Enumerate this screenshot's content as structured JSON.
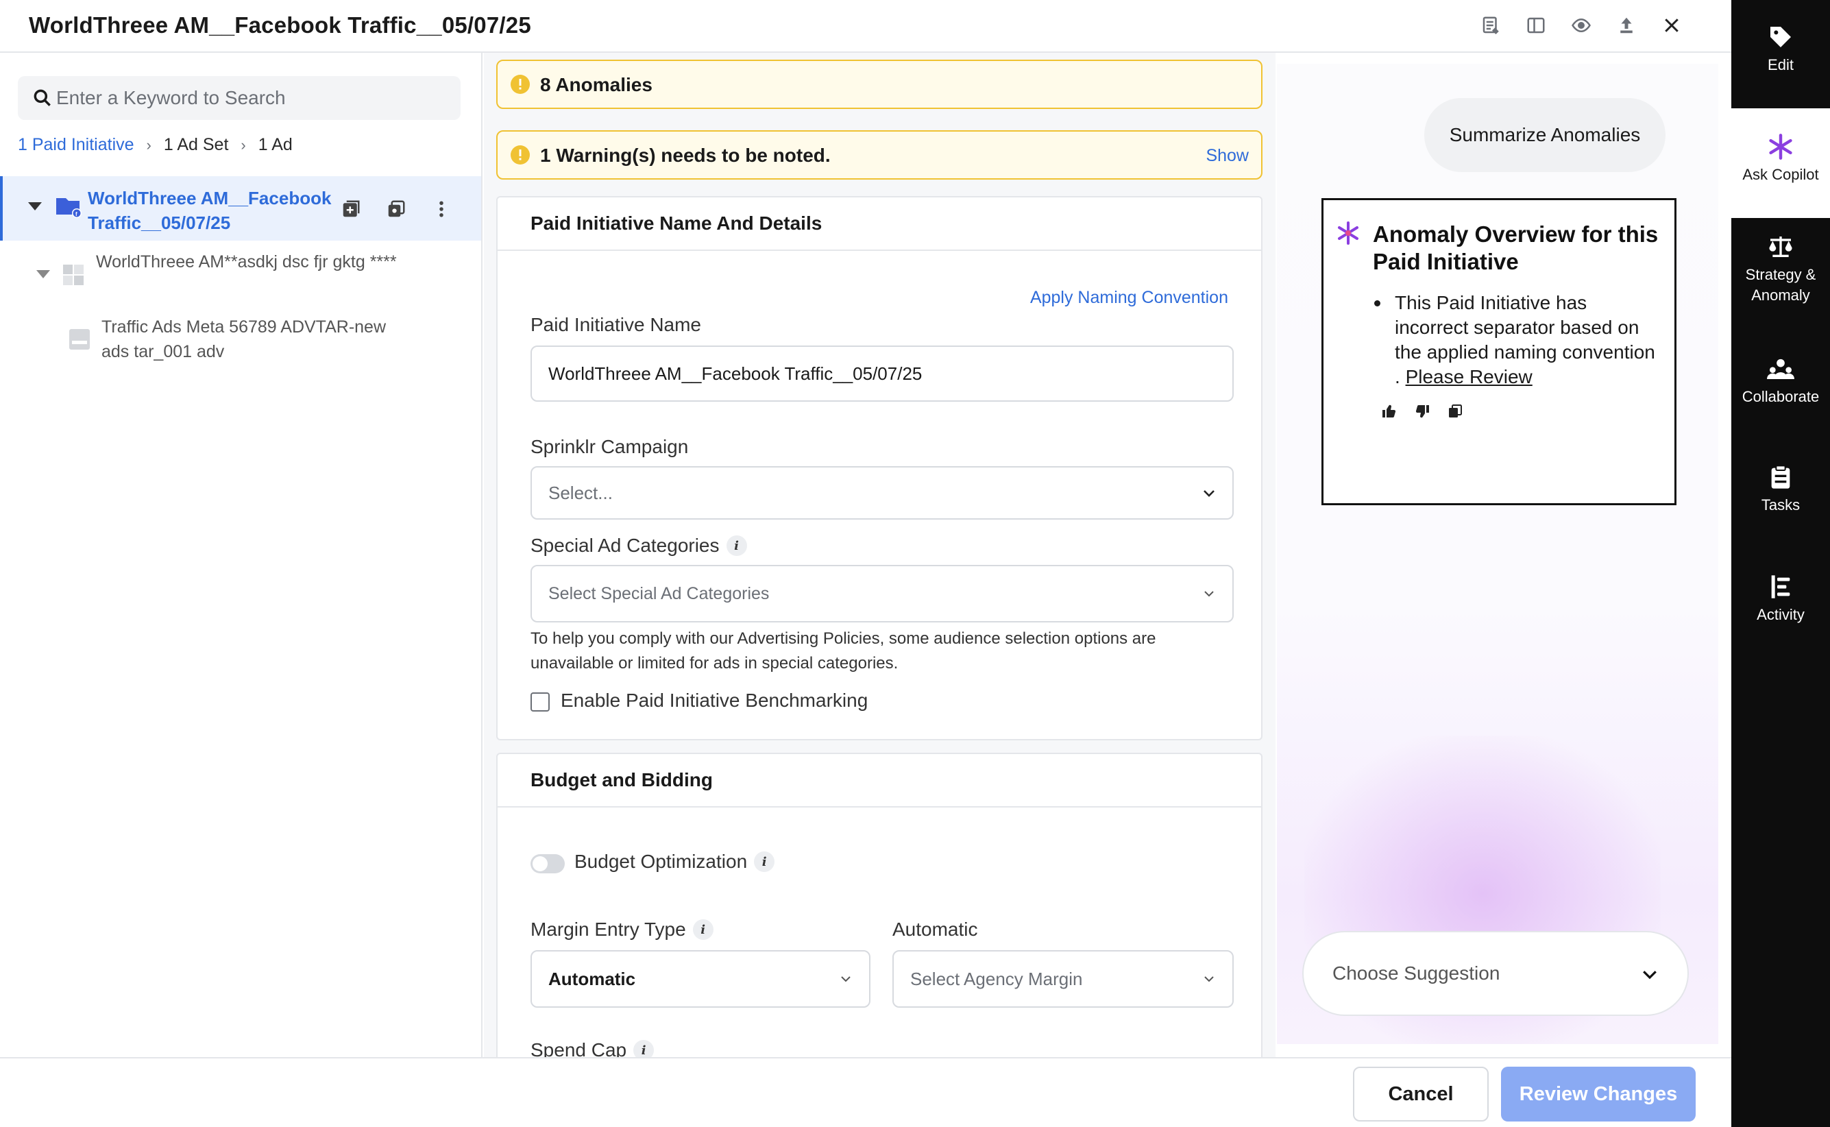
{
  "header": {
    "title": "WorldThreee AM__Facebook Traffic__05/07/25",
    "icons": [
      "list-edit-icon",
      "panel-layout-icon",
      "eye-icon",
      "upload-icon",
      "close-icon"
    ]
  },
  "left_panel": {
    "search_placeholder": "Enter a Keyword to Search",
    "breadcrumb": [
      "1 Paid Initiative",
      "1 Ad Set",
      "1 Ad"
    ],
    "tree": [
      {
        "label": "WorldThreee AM__Facebook Traffic__05/07/25",
        "type": "paid-initiative",
        "selected": true
      },
      {
        "label": "WorldThreee AM**asdkj dsc fjr gktg ****",
        "type": "ad-set"
      },
      {
        "label": "Traffic Ads Meta 56789 ADVTAR-new ads tar_001 adv",
        "type": "ad"
      }
    ]
  },
  "alerts": {
    "anomalies": "8 Anomalies",
    "warnings": "1 Warning(s) needs to be noted.",
    "show_label": "Show"
  },
  "details_section": {
    "title": "Paid Initiative Name And Details",
    "apply_naming": "Apply Naming Convention",
    "name_label": "Paid Initiative Name",
    "name_value": "WorldThreee AM__Facebook Traffic__05/07/25",
    "campaign_label": "Sprinklr Campaign",
    "campaign_placeholder": "Select...",
    "special_label": "Special Ad Categories",
    "special_placeholder": "Select Special Ad Categories",
    "special_helper": "To help you comply with our Advertising Policies, some audience selection options are unavailable or limited for ads in special categories.",
    "benchmark_label": "Enable Paid Initiative Benchmarking",
    "benchmark_checked": false
  },
  "budget_section": {
    "title": "Budget and Bidding",
    "optimization_label": "Budget Optimization",
    "optimization_on": false,
    "margin_type_label": "Margin Entry Type",
    "margin_type_value": "Automatic",
    "automatic_label": "Automatic",
    "agency_margin_placeholder": "Select Agency Margin",
    "spend_cap_label": "Spend Cap"
  },
  "copilot": {
    "chip": "Summarize Anomalies",
    "overview_title": "Anomaly Overview for this Paid Initiative",
    "overview_text": "This Paid Initiative has incorrect separator based on the applied naming convention .",
    "review_link": "Please Review",
    "suggestion_placeholder": "Choose Suggestion",
    "accent": "#8b3fe0"
  },
  "rail": {
    "items": [
      {
        "label": "Edit",
        "icon": "tag-icon"
      },
      {
        "label": "Ask Copilot",
        "icon": "sparkle-icon",
        "active": true
      },
      {
        "label": "Strategy & Anomaly",
        "icon": "scale-icon"
      },
      {
        "label": "Collaborate",
        "icon": "people-icon"
      },
      {
        "label": "Tasks",
        "icon": "clipboard-icon"
      },
      {
        "label": "Activity",
        "icon": "activity-icon"
      }
    ]
  },
  "footer": {
    "cancel": "Cancel",
    "review": "Review Changes"
  },
  "colors": {
    "link": "#2e6bd9",
    "alert_border": "#f0c233",
    "primary_disabled": "#8aaaf3"
  }
}
